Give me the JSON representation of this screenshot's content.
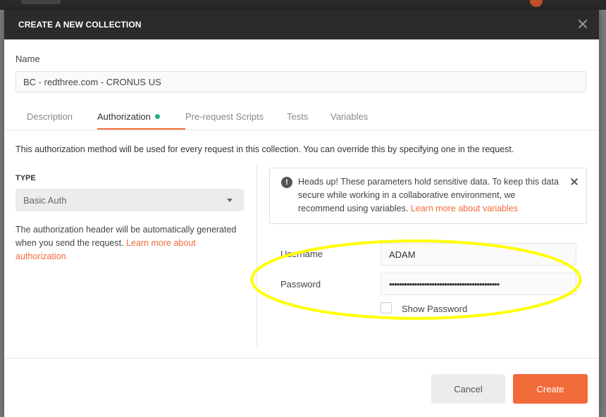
{
  "modal": {
    "title": "CREATE A NEW COLLECTION",
    "name_label": "Name",
    "name_value": "BC - redthree.com - CRONUS US"
  },
  "tabs": [
    {
      "label": "Description"
    },
    {
      "label": "Authorization"
    },
    {
      "label": "Pre-request Scripts"
    },
    {
      "label": "Tests"
    },
    {
      "label": "Variables"
    }
  ],
  "auth": {
    "intro": "This authorization method will be used for every request in this collection. You can override this by specifying one in the request.",
    "type_label": "TYPE",
    "type_value": "Basic Auth",
    "help_text": "The authorization header will be automatically generated when you send the request.",
    "help_link": "Learn more about authorization"
  },
  "alert": {
    "text": "Heads up! These parameters hold sensitive data. To keep this data secure while working in a collaborative environment, we recommend using variables.",
    "link": "Learn more about variables"
  },
  "fields": {
    "username_label": "Username",
    "username_value": "ADAM",
    "password_label": "Password",
    "password_value": "••••••••••••••••••••••••••••••••••••••••••••",
    "show_password_label": "Show Password"
  },
  "footer": {
    "cancel_label": "Cancel",
    "create_label": "Create"
  },
  "colors": {
    "accent": "#f26b3a",
    "header": "#2b2b2b",
    "active_dot": "#26b47f",
    "highlight": "#ffff00"
  }
}
